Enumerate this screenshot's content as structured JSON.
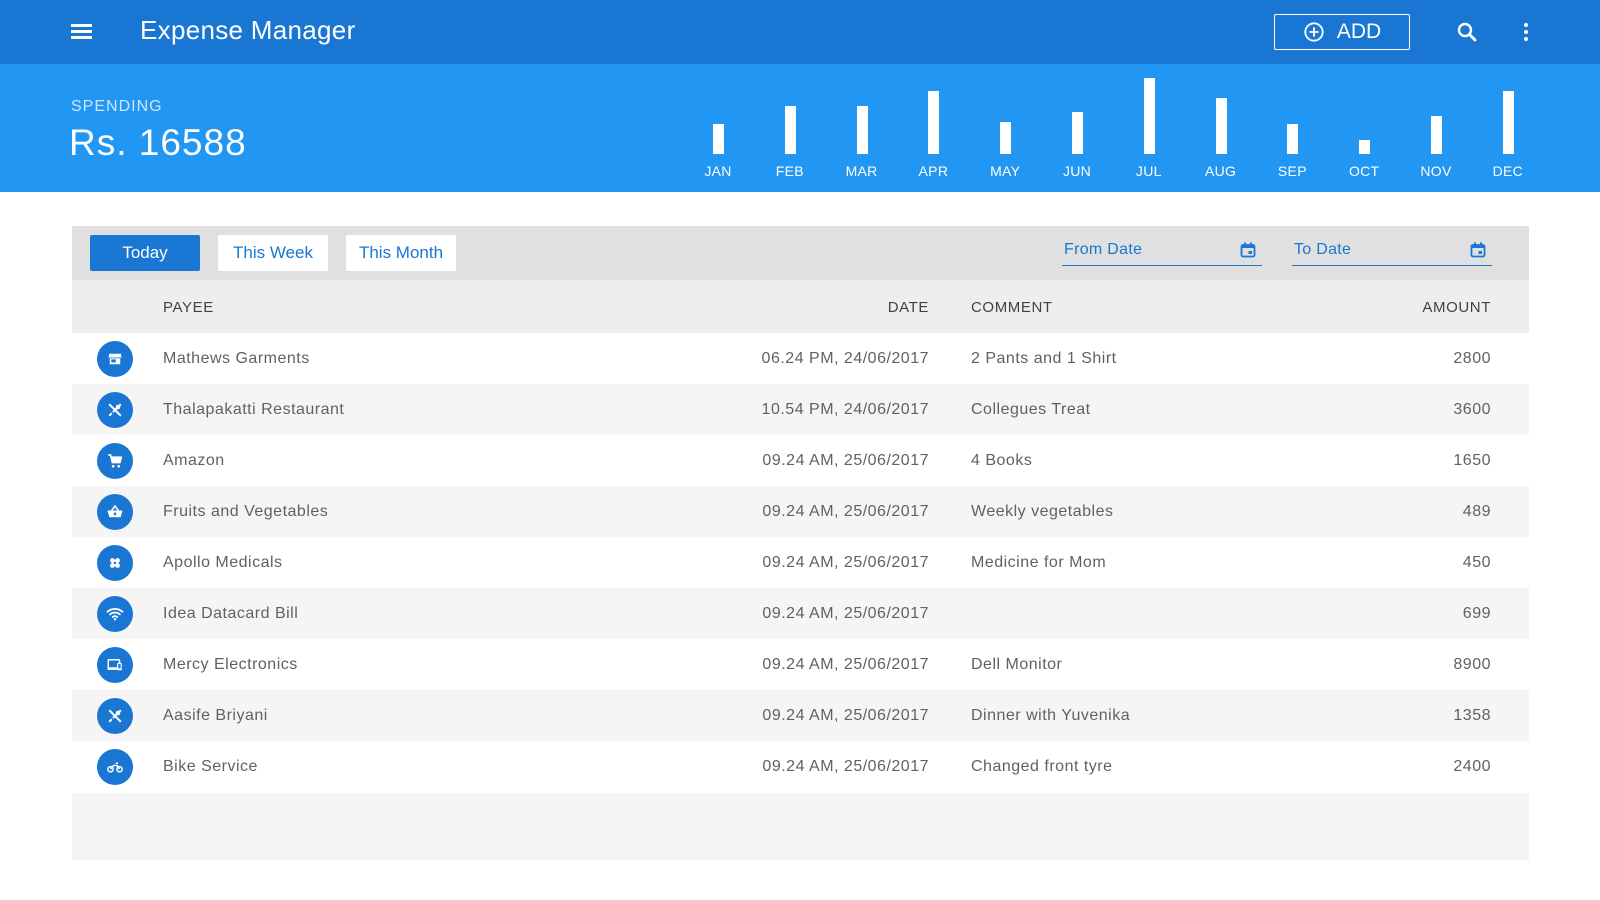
{
  "app": {
    "title": "Expense Manager",
    "add_label": "ADD"
  },
  "summary": {
    "label": "SPENDING",
    "value": "Rs. 16588"
  },
  "chart_data": {
    "type": "bar",
    "categories": [
      "JAN",
      "FEB",
      "MAR",
      "APR",
      "MAY",
      "JUN",
      "JUL",
      "AUG",
      "SEP",
      "OCT",
      "NOV",
      "DEC"
    ],
    "values": [
      30,
      48,
      48,
      63,
      32,
      42,
      76,
      56,
      30,
      14,
      38,
      63
    ],
    "bar_color": "#ffffff"
  },
  "filters": {
    "tabs": [
      {
        "label": "Today",
        "active": true
      },
      {
        "label": "This Week",
        "active": false
      },
      {
        "label": "This Month",
        "active": false
      }
    ],
    "from_date_placeholder": "From Date",
    "to_date_placeholder": "To Date"
  },
  "table": {
    "columns": {
      "payee": "PAYEE",
      "date": "DATE",
      "comment": "COMMENT",
      "amount": "AMOUNT"
    },
    "rows": [
      {
        "icon": "store-icon",
        "payee": "Mathews Garments",
        "date": "06.24 PM, 24/06/2017",
        "comment": "2 Pants and 1 Shirt",
        "amount": "2800"
      },
      {
        "icon": "restaurant-icon",
        "payee": "Thalapakatti Restaurant",
        "date": "10.54 PM, 24/06/2017",
        "comment": "Collegues Treat",
        "amount": "3600"
      },
      {
        "icon": "cart-icon",
        "payee": "Amazon",
        "date": "09.24 AM, 25/06/2017",
        "comment": "4 Books",
        "amount": "1650"
      },
      {
        "icon": "basket-icon",
        "payee": "Fruits and Vegetables",
        "date": "09.24 AM, 25/06/2017",
        "comment": "Weekly vegetables",
        "amount": "489"
      },
      {
        "icon": "medical-icon",
        "payee": "Apollo Medicals",
        "date": "09.24 AM, 25/06/2017",
        "comment": "Medicine for Mom",
        "amount": "450"
      },
      {
        "icon": "wifi-icon",
        "payee": "Idea Datacard Bill",
        "date": "09.24 AM, 25/06/2017",
        "comment": "",
        "amount": "699"
      },
      {
        "icon": "devices-icon",
        "payee": "Mercy Electronics",
        "date": "09.24 AM, 25/06/2017",
        "comment": "Dell Monitor",
        "amount": "8900"
      },
      {
        "icon": "restaurant-icon",
        "payee": "Aasife Briyani",
        "date": "09.24 AM, 25/06/2017",
        "comment": "Dinner with Yuvenika",
        "amount": "1358"
      },
      {
        "icon": "motorcycle-icon",
        "payee": "Bike Service",
        "date": "09.24 AM, 25/06/2017",
        "comment": "Changed front tyre",
        "amount": "2400"
      }
    ]
  },
  "colors": {
    "appbar": "#1976d2",
    "band": "#2196f3",
    "accent": "#1976d2"
  }
}
